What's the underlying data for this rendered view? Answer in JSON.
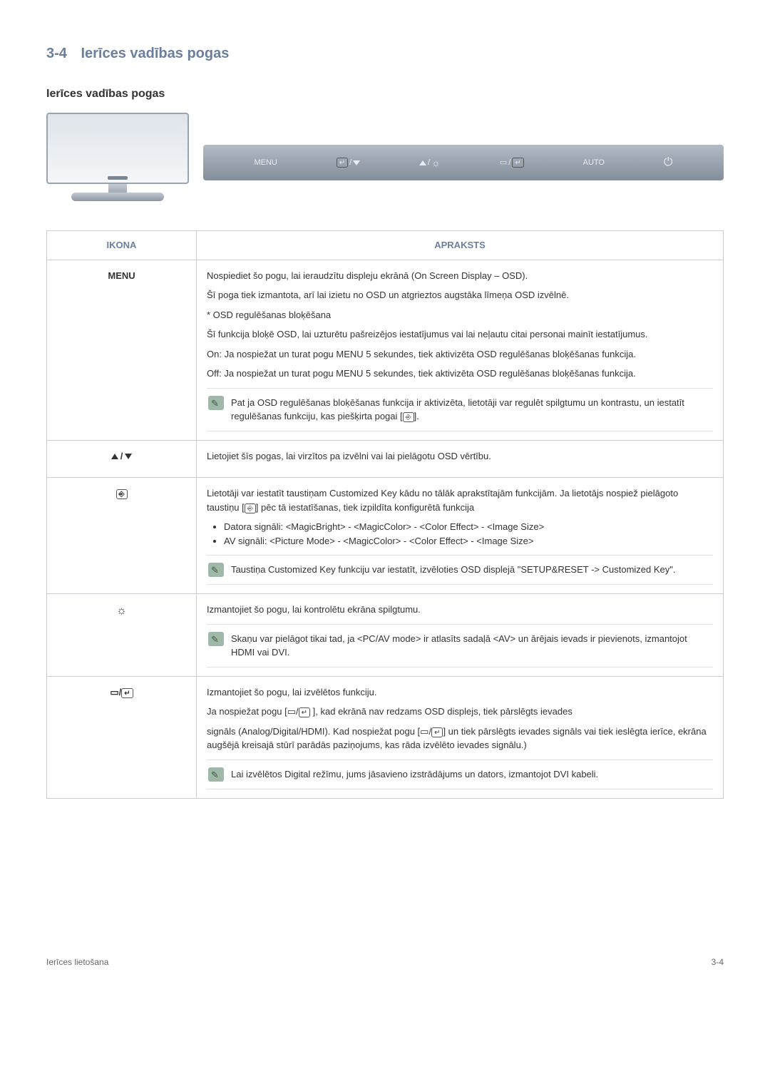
{
  "header": {
    "num": "3-4",
    "title": "Ierīces vadības pogas"
  },
  "subheading": "Ierīces vadības pogas",
  "button_bar": {
    "menu": "MENU",
    "enter_down": "/",
    "up_bright": "/",
    "source_enter": "/",
    "auto": "AUTO"
  },
  "table": {
    "head_icon": "IKONA",
    "head_desc": "APRAKSTS",
    "rows": {
      "menu": {
        "label": "MENU",
        "p1": "Nospiediet šo pogu, lai ieraudzītu displeju ekrānā (On Screen Display – OSD).",
        "p2": "Šī poga tiek izmantota, arī lai izietu no OSD un atgrieztos augstāka līmeņa OSD izvēlnē.",
        "p3": "* OSD regulēšanas bloķēšana",
        "p4": "Šī funkcija bloķē OSD, lai uzturētu pašreizējos iestatījumus vai lai neļautu citai personai mainīt iestatījumus.",
        "p5": "On: Ja nospiežat un turat pogu MENU 5 sekundes, tiek aktivizēta OSD regulēšanas bloķēšanas funkcija.",
        "p6": "Off: Ja nospiežat un turat pogu MENU 5 sekundes, tiek aktivizēta OSD regulēšanas bloķēšanas funkcija.",
        "note": "Pat ja OSD regulēšanas bloķēšanas funkcija ir aktivizēta, lietotāji var regulēt spilgtumu un kontrastu, un iestatīt regulēšanas funkciju, kas piešķirta pogai ["
      },
      "arrows": {
        "p1": "Lietojiet šīs pogas, lai virzītos pa izvēlni vai lai pielāgotu OSD vērtību."
      },
      "custom": {
        "p1a": "Lietotāji var iestatīt taustiņam Customized Key kādu no tālāk aprakstītajām funkcijām. Ja lietotājs nospiež pielāgoto taustiņu [",
        "p1b": "] pēc tā iestatīšanas, tiek izpildīta konfigurētā funkcija",
        "b1": "Datora signāli: <MagicBright> - <MagicColor> - <Color Effect> - <Image Size>",
        "b2": "AV signāli: <Picture Mode> - <MagicColor> - <Color Effect> - <Image Size>",
        "note": "Taustiņa Customized Key funkciju var iestatīt, izvēloties OSD displejā \"SETUP&RESET -> Customized Key\"."
      },
      "bright": {
        "p1": "Izmantojiet šo pogu, lai kontrolētu ekrāna spilgtumu.",
        "note": "Skaņu var pielāgot tikai tad, ja <PC/AV mode> ir atlasīts sadaļā <AV> un ārējais ievads ir pievienots, izmantojot HDMI vai DVI."
      },
      "source": {
        "p1": "Izmantojiet šo pogu, lai izvēlētos funkciju.",
        "p2a": "Ja nospiežat pogu [",
        "p2b": " ], kad ekrānā nav redzams OSD displejs, tiek pārslēgts ievades",
        "p3a": "signāls (Analog/Digital/HDMI). Kad nospiežat pogu [",
        "p3b": "] un tiek pārslēgts ievades signāls vai tiek ieslēgta ierīce, ekrāna augšējā kreisajā stūrī parādās paziņojums, kas rāda izvēlēto ievades signālu.)",
        "note": "Lai izvēlētos Digital režīmu, jums jāsavieno izstrādājums un dators, izmantojot DVI kabeli."
      }
    }
  },
  "footer": {
    "left": "Ierīces lietošana",
    "right": "3-4"
  }
}
